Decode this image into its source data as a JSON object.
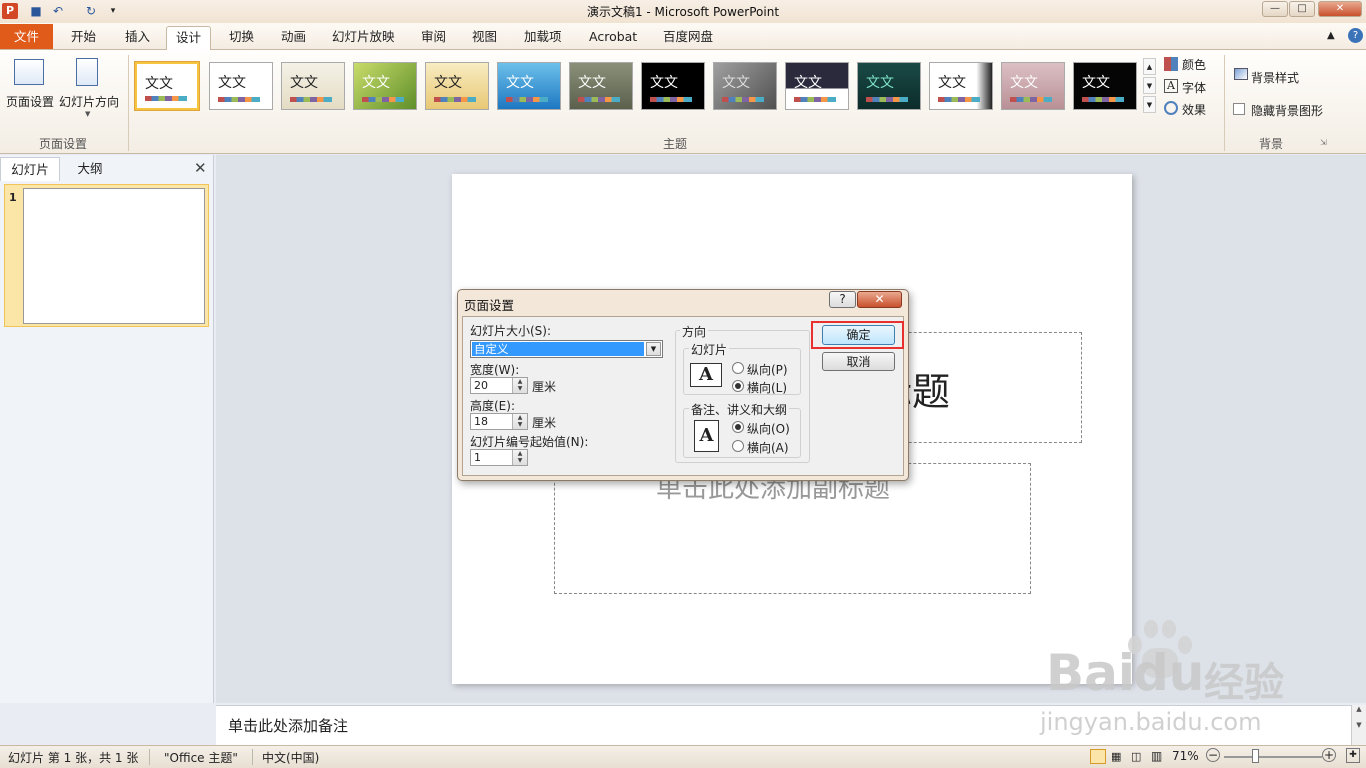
{
  "window": {
    "title": "演示文稿1 - Microsoft PowerPoint",
    "app_icon": "P"
  },
  "qat": {
    "save_icon": "save-icon",
    "undo_icon": "undo-icon",
    "redo_icon": "redo-icon",
    "customize_icon": "dropdown-icon"
  },
  "window_controls": {
    "minimize": "—",
    "maximize": "□",
    "close": "✕"
  },
  "tabs": {
    "file": "文件",
    "home": "开始",
    "insert": "插入",
    "design": "设计",
    "transitions": "切换",
    "animations": "动画",
    "slideshow": "幻灯片放映",
    "review": "审阅",
    "view": "视图",
    "addins": "加载项",
    "acrobat": "Acrobat",
    "baidu": "百度网盘"
  },
  "ribbon": {
    "page_setup": {
      "btn1": "页面设置",
      "btn2": "幻灯片方向",
      "label": "页面设置"
    },
    "themes": {
      "label": "主题",
      "sample_text": "文文"
    },
    "theme_options": {
      "colors": "颜色",
      "fonts": "字体",
      "effects": "效果"
    },
    "background": {
      "styles": "背景样式",
      "hide_graphics": "隐藏背景图形",
      "label": "背景"
    }
  },
  "left_panel": {
    "tab_slides": "幻灯片",
    "tab_outline": "大纲",
    "slide_number": "1"
  },
  "slide": {
    "title_fragment": "标题",
    "subtitle": "单击此处添加副标题"
  },
  "notes": {
    "placeholder": "单击此处添加备注"
  },
  "status": {
    "slide_info": "幻灯片 第 1 张，共 1 张",
    "theme": "\"Office 主题\"",
    "language": "中文(中国)",
    "zoom": "71%"
  },
  "dialog": {
    "title": "页面设置",
    "help": "?",
    "close": "✕",
    "size_label": "幻灯片大小(S):",
    "size_value": "自定义",
    "width_label": "宽度(W):",
    "width_value": "20",
    "unit": "厘米",
    "height_label": "高度(E):",
    "height_value": "18",
    "number_label": "幻灯片编号起始值(N):",
    "number_value": "1",
    "orientation_label": "方向",
    "slides_label": "幻灯片",
    "portrait": "纵向(P)",
    "landscape": "横向(L)",
    "notes_label": "备注、讲义和大纲",
    "notes_portrait": "纵向(O)",
    "notes_landscape": "横向(A)",
    "ok": "确定",
    "cancel": "取消"
  },
  "watermark": {
    "brand": "Bai",
    "brand2": "du",
    "cn": "经验",
    "url": "jingyan.baidu.com"
  },
  "colors": {
    "file_tab": "#e05a1a",
    "highlight": "#e8312f",
    "selected_thumb": "#f5c542"
  }
}
